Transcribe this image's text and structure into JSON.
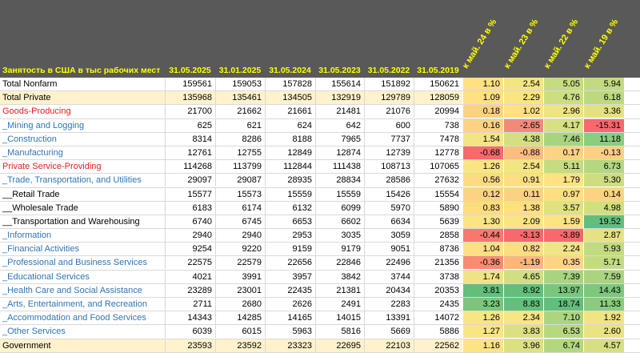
{
  "header": {
    "title": "Занятость в США в тыс рабочих мест",
    "dates": [
      "31.05.2025",
      "31.01.2025",
      "31.05.2024",
      "31.05.2023",
      "31.05.2022",
      "31.05.2019"
    ],
    "pct_cols": [
      "к май. 24 в %",
      "к май. 23 в %",
      "к май. 22 в %",
      "к май. 19 в %"
    ]
  },
  "colors": {
    "header_bg": "#595959",
    "header_text": "#ffff00",
    "total_row_bg": "#fff2cc",
    "sector_label": "#e02020",
    "sub_label": "#2f75b5"
  },
  "rows": [
    {
      "label": "Total Nonfarm",
      "style": "black",
      "highlight": false,
      "values": [
        "159561",
        "159053",
        "157828",
        "155614",
        "151892",
        "150621"
      ],
      "pcts": [
        "1.10",
        "2.54",
        "5.05",
        "5.94"
      ],
      "pct_colors": [
        "#ffe083",
        "#f4e583",
        "#c6dc80",
        "#c3db80"
      ]
    },
    {
      "label": "Total Private",
      "style": "black",
      "highlight": true,
      "values": [
        "135968",
        "135461",
        "134505",
        "132919",
        "129789",
        "128059"
      ],
      "pcts": [
        "1.09",
        "2.29",
        "4.76",
        "6.18"
      ],
      "pct_colors": [
        "#ffe083",
        "#fae583",
        "#cbde81",
        "#bdd980"
      ]
    },
    {
      "label": "Goods-Producing",
      "style": "red",
      "highlight": false,
      "values": [
        "21700",
        "21662",
        "21661",
        "21481",
        "21076",
        "20994"
      ],
      "pcts": [
        "0.18",
        "1.02",
        "2.96",
        "3.36"
      ],
      "pct_colors": [
        "#fdd283",
        "#ffe083",
        "#ede484",
        "#e3e283"
      ]
    },
    {
      "label": "_Mining and Logging",
      "style": "blue",
      "highlight": false,
      "values": [
        "625",
        "621",
        "624",
        "642",
        "600",
        "738"
      ],
      "pcts": [
        "0.16",
        "-2.65",
        "4.17",
        "-15.31"
      ],
      "pct_colors": [
        "#fdd283",
        "#f28a7a",
        "#d7e082",
        "#f8696b"
      ]
    },
    {
      "label": "_Construction",
      "style": "blue",
      "highlight": false,
      "values": [
        "8314",
        "8286",
        "8188",
        "7965",
        "7737",
        "7478"
      ],
      "pcts": [
        "1.54",
        "4.38",
        "7.46",
        "11.18"
      ],
      "pct_colors": [
        "#f3e584",
        "#d3df82",
        "#a8d47f",
        "#8ccc7e"
      ]
    },
    {
      "label": "_Manufacturing",
      "style": "blue",
      "highlight": false,
      "values": [
        "12761",
        "12755",
        "12849",
        "12874",
        "12739",
        "12778"
      ],
      "pcts": [
        "-0.68",
        "-0.88",
        "0.17",
        "-0.13"
      ],
      "pct_colors": [
        "#f8696b",
        "#fcbd7f",
        "#fdd283",
        "#fccf82"
      ]
    },
    {
      "label": "Private Service-Providing",
      "style": "red",
      "highlight": false,
      "values": [
        "114268",
        "113799",
        "112844",
        "111438",
        "108713",
        "107065"
      ],
      "pcts": [
        "1.26",
        "2.54",
        "5.11",
        "6.73"
      ],
      "pct_colors": [
        "#fae583",
        "#f4e583",
        "#c6dc80",
        "#b5d780"
      ]
    },
    {
      "label": "_Trade, Transportation, and Utilities",
      "style": "blue",
      "highlight": false,
      "values": [
        "29097",
        "29087",
        "28935",
        "28834",
        "28586",
        "27632"
      ],
      "pcts": [
        "0.56",
        "0.91",
        "1.79",
        "5.30"
      ],
      "pct_colors": [
        "#feda83",
        "#fede83",
        "#fee283",
        "#cfdd81"
      ]
    },
    {
      "label": "__Retail Trade",
      "style": "black",
      "highlight": false,
      "values": [
        "15577",
        "15573",
        "15559",
        "15559",
        "15426",
        "15554"
      ],
      "pcts": [
        "0.12",
        "0.11",
        "0.97",
        "0.14"
      ],
      "pct_colors": [
        "#fdd283",
        "#fdd183",
        "#fede83",
        "#fcd383"
      ]
    },
    {
      "label": "__Wholesale Trade",
      "style": "black",
      "highlight": false,
      "values": [
        "6183",
        "6174",
        "6132",
        "6099",
        "5970",
        "5890"
      ],
      "pcts": [
        "0.83",
        "1.38",
        "3.57",
        "4.98"
      ],
      "pct_colors": [
        "#fedc83",
        "#ffe083",
        "#e0e183",
        "#d3de82"
      ]
    },
    {
      "label": "__Transportation and Warehousing",
      "style": "black",
      "highlight": false,
      "values": [
        "6740",
        "6745",
        "6653",
        "6602",
        "6634",
        "5639"
      ],
      "pcts": [
        "1.30",
        "2.09",
        "1.59",
        "19.52"
      ],
      "pct_colors": [
        "#fae583",
        "#fae583",
        "#fee383",
        "#63be7b"
      ]
    },
    {
      "label": "_Information",
      "style": "blue",
      "highlight": false,
      "values": [
        "2940",
        "2940",
        "2953",
        "3035",
        "3059",
        "2858"
      ],
      "pcts": [
        "-0.44",
        "-3.13",
        "-3.89",
        "2.87"
      ],
      "pct_colors": [
        "#f8786f",
        "#f8696b",
        "#f8696b",
        "#e6e283"
      ]
    },
    {
      "label": "_Financial Activities",
      "style": "blue",
      "highlight": false,
      "values": [
        "9254",
        "9220",
        "9159",
        "9179",
        "9051",
        "8736"
      ],
      "pcts": [
        "1.04",
        "0.82",
        "2.24",
        "5.93"
      ],
      "pct_colors": [
        "#ffdf83",
        "#fedc83",
        "#f1e484",
        "#c1db80"
      ]
    },
    {
      "label": "_Professional and Business Services",
      "style": "blue",
      "highlight": false,
      "values": [
        "22575",
        "22579",
        "22656",
        "22846",
        "22496",
        "21356"
      ],
      "pcts": [
        "-0.36",
        "-1.19",
        "0.35",
        "5.71"
      ],
      "pct_colors": [
        "#f98b73",
        "#fbb67d",
        "#fdd483",
        "#c4dc80"
      ]
    },
    {
      "label": "_Educational Services",
      "style": "blue",
      "highlight": false,
      "values": [
        "4021",
        "3991",
        "3957",
        "3842",
        "3744",
        "3738"
      ],
      "pcts": [
        "1.74",
        "4.65",
        "7.39",
        "7.59"
      ],
      "pct_colors": [
        "#eee484",
        "#d1de82",
        "#a9d47f",
        "#aad47f"
      ]
    },
    {
      "label": "_Health Care and Social Assistance",
      "style": "blue",
      "highlight": false,
      "values": [
        "23289",
        "23001",
        "22435",
        "21381",
        "20434",
        "20353"
      ],
      "pcts": [
        "3.81",
        "8.92",
        "13.97",
        "14.43"
      ],
      "pct_colors": [
        "#63be7b",
        "#63be7b",
        "#7ac67d",
        "#7ec77d"
      ]
    },
    {
      "label": "_Arts, Entertainment, and Recreation",
      "style": "blue",
      "highlight": false,
      "values": [
        "2711",
        "2680",
        "2626",
        "2491",
        "2283",
        "2435"
      ],
      "pcts": [
        "3.23",
        "8.83",
        "18.74",
        "11.33"
      ],
      "pct_colors": [
        "#7ac67d",
        "#65bf7b",
        "#63be7b",
        "#8acb7e"
      ]
    },
    {
      "label": "_Accommodation and Food Services",
      "style": "blue",
      "highlight": false,
      "values": [
        "14343",
        "14285",
        "14165",
        "14015",
        "13391",
        "14072"
      ],
      "pcts": [
        "1.26",
        "2.34",
        "7.10",
        "1.92"
      ],
      "pct_colors": [
        "#fae583",
        "#f8e583",
        "#acd57f",
        "#f1e484"
      ]
    },
    {
      "label": "_Other Services",
      "style": "blue",
      "highlight": false,
      "values": [
        "6039",
        "6015",
        "5963",
        "5816",
        "5669",
        "5886"
      ],
      "pcts": [
        "1.27",
        "3.83",
        "6.53",
        "2.60"
      ],
      "pct_colors": [
        "#fae583",
        "#dde082",
        "#b7d880",
        "#e9e383"
      ]
    },
    {
      "label": "Government",
      "style": "black",
      "highlight": true,
      "values": [
        "23593",
        "23592",
        "23323",
        "22695",
        "22103",
        "22562"
      ],
      "pcts": [
        "1.16",
        "3.96",
        "6.74",
        "4.57"
      ],
      "pct_colors": [
        "#fde483",
        "#dbe082",
        "#b3d780",
        "#d8df82"
      ]
    }
  ]
}
